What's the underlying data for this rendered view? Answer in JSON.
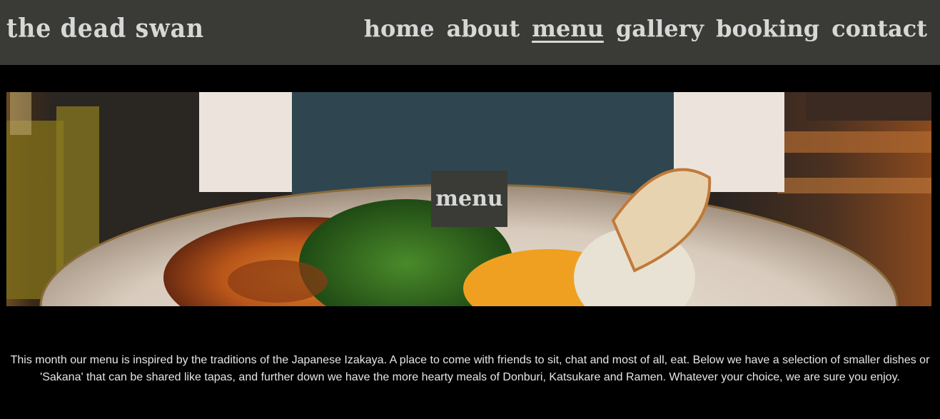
{
  "header": {
    "logo": "the dead swan",
    "nav": [
      {
        "label": "home",
        "active": false
      },
      {
        "label": "about",
        "active": false
      },
      {
        "label": "menu",
        "active": true
      },
      {
        "label": "gallery",
        "active": false
      },
      {
        "label": "booking",
        "active": false
      },
      {
        "label": "contact",
        "active": false
      }
    ]
  },
  "hero": {
    "label": "menu"
  },
  "intro": {
    "text": "This month our menu is inspired by the traditions of the Japanese Izakaya. A place to come with friends to sit, chat and most of all, eat. Below we have a selection of smaller dishes or 'Sakana' that can be shared like tapas, and further down we have the more hearty meals of Donburi, Katsukare and Ramen. Whatever your choice, we are sure you enjoy."
  },
  "colors": {
    "header_bg": "#3a3b37",
    "header_text": "#d5d8d6",
    "page_bg": "#000000",
    "body_text": "#e6e6e6"
  }
}
